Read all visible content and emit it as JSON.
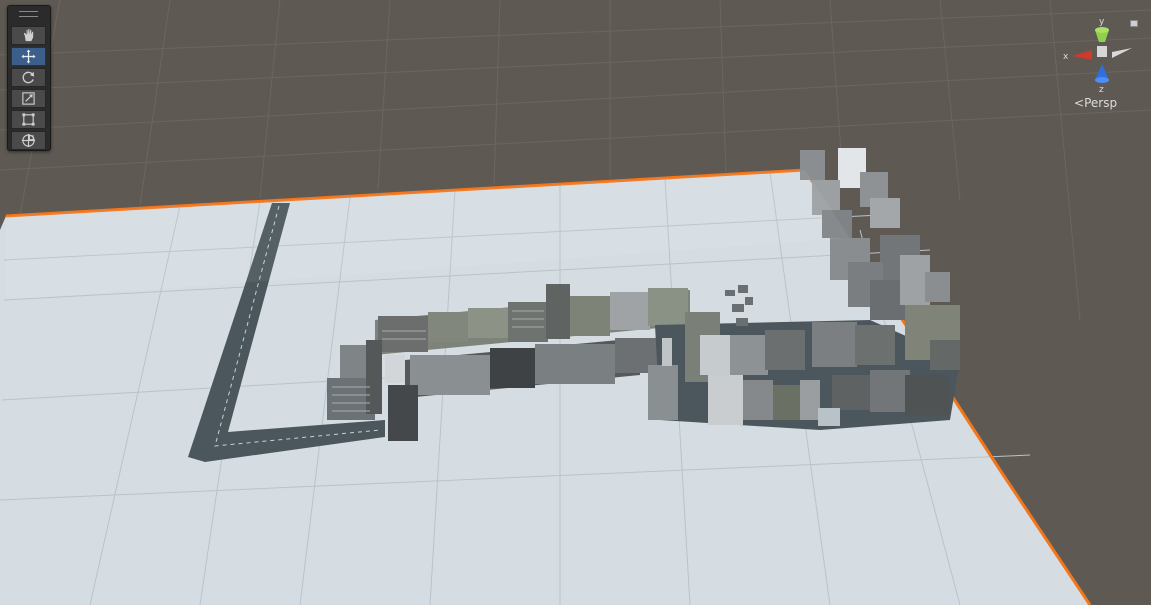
{
  "toolbar": {
    "tools": [
      {
        "name": "view-tool",
        "icon": "hand-icon",
        "active": false
      },
      {
        "name": "move-tool",
        "icon": "move-arrows-icon",
        "active": true
      },
      {
        "name": "rotate-tool",
        "icon": "rotate-icon",
        "active": false
      },
      {
        "name": "scale-tool",
        "icon": "scale-icon",
        "active": false
      },
      {
        "name": "rect-tool",
        "icon": "rect-transform-icon",
        "active": false
      },
      {
        "name": "transform-tool",
        "icon": "transform-icon",
        "active": false
      }
    ]
  },
  "gizmo": {
    "axis_y_label": "y",
    "axis_x_label": "x",
    "axis_z_label": "z",
    "projection_label": "Persp",
    "colors": {
      "x": "#d0392b",
      "y": "#8ed14a",
      "z": "#2f6fe0"
    }
  },
  "scene": {
    "ground_color": "#d5dde3",
    "selection_outline_color": "#f2761c",
    "background_color": "#5f5954"
  }
}
